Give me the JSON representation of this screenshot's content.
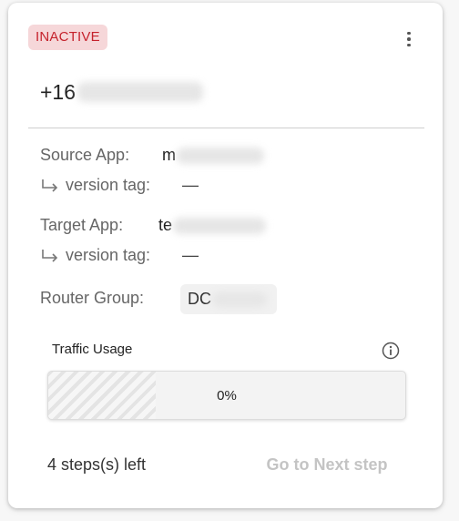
{
  "status": {
    "label": "INACTIVE",
    "color": "#c5222c",
    "background": "#f6d7d9"
  },
  "menu": {
    "icon": "more-vertical-icon"
  },
  "phone": {
    "prefix": "+16"
  },
  "source": {
    "label": "Source App:",
    "value_prefix": "m",
    "version_label": "version tag:",
    "version_value": "—"
  },
  "target": {
    "label": "Target App:",
    "value_prefix": "te",
    "version_label": "version tag:",
    "version_value": "—"
  },
  "router": {
    "label": "Router Group:",
    "value_prefix": "DC"
  },
  "traffic": {
    "label": "Traffic Usage",
    "percent_text": "0%",
    "info_icon": "info-icon"
  },
  "footer": {
    "steps_left": "4 steps(s) left",
    "next_label": "Go to Next step"
  }
}
